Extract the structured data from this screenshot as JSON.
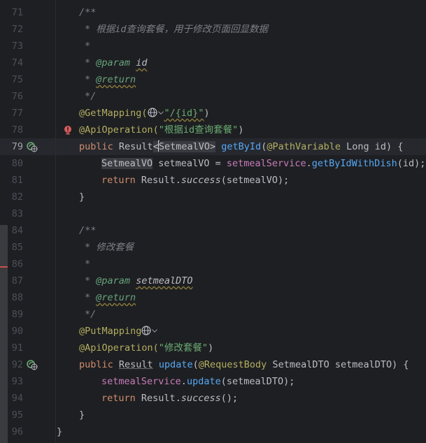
{
  "editor": {
    "current_line": "79",
    "lines": [
      {
        "n": "71",
        "t": "/**"
      },
      {
        "n": "72",
        "t": "* 根据id查询套餐，用于修改页面回显数据"
      },
      {
        "n": "73",
        "t": "*"
      },
      {
        "n": "74",
        "t1": "* ",
        "tag": "@param",
        "t2": " ",
        "p": "id"
      },
      {
        "n": "75",
        "t1": "* ",
        "tag": "@return"
      },
      {
        "n": "76",
        "t": "*/"
      },
      {
        "n": "77",
        "ann": "@GetMapping(",
        "str": "\"/{id}\"",
        "end": ")"
      },
      {
        "n": "78",
        "ann": "@ApiOperation(",
        "str": "\"根据id查询套餐\"",
        "end": ")"
      },
      {
        "n": "79",
        "kw": "public",
        "type1": "Result",
        "lt": "<",
        "type2": "SetmealVO",
        "gt": ">",
        "fn": "getById",
        "ann": "@PathVariable",
        "rest": "Long id) {"
      },
      {
        "n": "80",
        "type": "SetmealVO",
        "mid": "setmealVO = ",
        "field": "setmealService",
        "dot": ".",
        "fn": "getByIdWithDish",
        "rest": "(id);"
      },
      {
        "n": "81",
        "kw": "return",
        "a": "Result.",
        "it": "success",
        "rest": "(setmealVO);"
      },
      {
        "n": "82",
        "t": "}"
      },
      {
        "n": "83",
        "t": ""
      },
      {
        "n": "84",
        "t": "/**"
      },
      {
        "n": "85",
        "t": "* 修改套餐"
      },
      {
        "n": "86",
        "t": "*"
      },
      {
        "n": "87",
        "t1": "* ",
        "tag": "@param",
        "t2": " ",
        "p": "setmealDTO"
      },
      {
        "n": "88",
        "t1": "* ",
        "tag": "@return"
      },
      {
        "n": "89",
        "t": "*/"
      },
      {
        "n": "90",
        "ann": "@PutMapping"
      },
      {
        "n": "91",
        "ann": "@ApiOperation(",
        "str": "\"修改套餐\"",
        "end": ")"
      },
      {
        "n": "92",
        "kw": "public",
        "type1": "Result",
        "fn": "update",
        "ann": "@RequestBody",
        "rest": "SetmealDTO setmealDTO) {"
      },
      {
        "n": "93",
        "field": "setmealService",
        "dot": ".",
        "fn": "update",
        "rest": "(setmealDTO);"
      },
      {
        "n": "94",
        "kw": "return",
        "a": "Result.",
        "it": "success",
        "rest": "();"
      },
      {
        "n": "95",
        "t": "}"
      },
      {
        "n": "96",
        "t": "}"
      }
    ]
  },
  "icons": {
    "gutter_bean": "spring-web-endpoint-icon",
    "gutter_error": "error-lightbulb-icon",
    "inline_globe": "globe-endpoint-icon"
  },
  "colors": {
    "background": "#1e1f22",
    "keyword": "#cf8e6d",
    "annotation": "#b3ae60",
    "function": "#56a8f5",
    "string": "#6aab73",
    "comment": "#7a7e85",
    "field": "#c77dbb",
    "error": "#db5c5c"
  }
}
